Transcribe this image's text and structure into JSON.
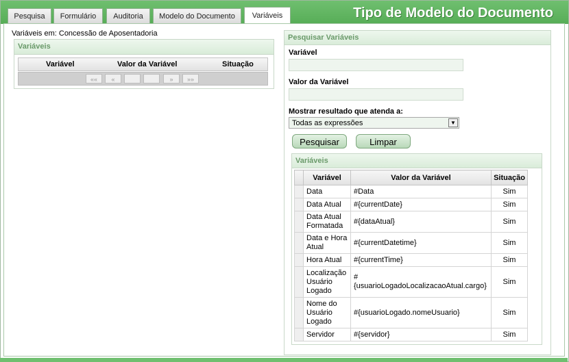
{
  "tabs": [
    {
      "label": "Pesquisa"
    },
    {
      "label": "Formulário"
    },
    {
      "label": "Auditoria"
    },
    {
      "label": "Modelo do Documento"
    },
    {
      "label": "Variáveis"
    }
  ],
  "page_title": "Tipo de Modelo do Documento",
  "left": {
    "context_label": "Variáveis em: Concessão de Aposentadoria",
    "panel_title": "Variáveis",
    "columns": [
      "Variável",
      "Valor da Variável",
      "Situação"
    ],
    "pager": [
      "««",
      "«",
      "",
      "",
      "»",
      "»»"
    ]
  },
  "search": {
    "panel_title": "Pesquisar Variáveis",
    "variavel_label": "Variável",
    "variavel_value": "",
    "valor_label": "Valor da Variável",
    "valor_value": "",
    "mostrar_label": "Mostrar resultado que atenda a:",
    "mostrar_selected": "Todas as expressões",
    "pesquisar_button": "Pesquisar",
    "limpar_button": "Limpar"
  },
  "results": {
    "panel_title": "Variáveis",
    "columns": [
      "Variável",
      "Valor da Variável",
      "Situação"
    ],
    "rows": [
      {
        "variavel": "Data",
        "valor": "#Data",
        "situacao": "Sim"
      },
      {
        "variavel": "Data Atual",
        "valor": "#{currentDate}",
        "situacao": "Sim"
      },
      {
        "variavel": "Data Atual Formatada",
        "valor": "#{dataAtual}",
        "situacao": "Sim"
      },
      {
        "variavel": "Data e Hora Atual",
        "valor": "#{currentDatetime}",
        "situacao": "Sim"
      },
      {
        "variavel": "Hora Atual",
        "valor": "#{currentTime}",
        "situacao": "Sim"
      },
      {
        "variavel": "Localização Usuário Logado",
        "valor": "#{usuarioLogadoLocalizacaoAtual.cargo}",
        "situacao": "Sim"
      },
      {
        "variavel": "Nome do Usuário Logado",
        "valor": "#{usuarioLogado.nomeUsuario}",
        "situacao": "Sim"
      },
      {
        "variavel": "Servidor",
        "valor": "#{servidor}",
        "situacao": "Sim"
      }
    ]
  }
}
